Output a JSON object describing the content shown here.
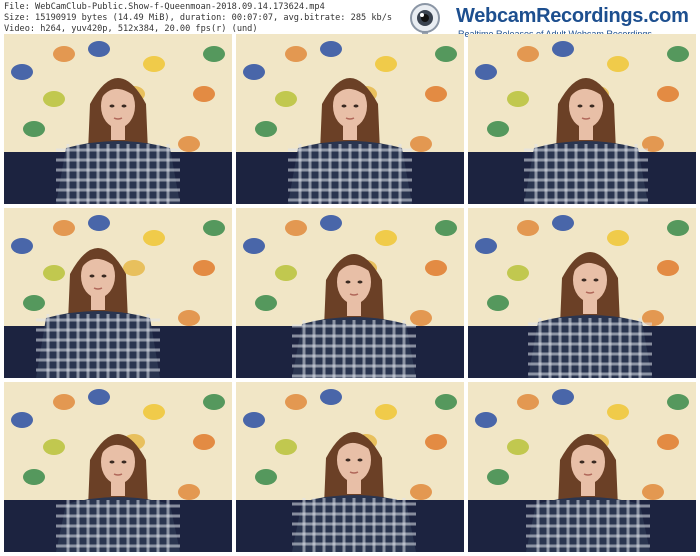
{
  "header": {
    "file_line": "File: WebCamClub-Public.Show-f-Queenmoan-2018.09.14.173624.mp4",
    "size_line": "Size: 15190919 bytes (14.49 MiB), duration: 00:07:07, avg.bitrate: 285 kb/s",
    "video_line": "Video: h264, yuv420p, 512x384, 20.00 fps(r) (und)"
  },
  "logo": {
    "title": "WebcamRecordings.com",
    "subtitle": "Realtime Releases of Adult Webcam Recordings"
  },
  "thumbnails": [
    {
      "name": "frame-1"
    },
    {
      "name": "frame-2"
    },
    {
      "name": "frame-3"
    },
    {
      "name": "frame-4"
    },
    {
      "name": "frame-5"
    },
    {
      "name": "frame-6"
    },
    {
      "name": "frame-7"
    },
    {
      "name": "frame-8"
    },
    {
      "name": "frame-9"
    }
  ],
  "colors": {
    "curtain": "#f1e6c6",
    "sofa": "#1c2340",
    "shirt_dark": "#2a3550",
    "shirt_light": "#dfe4ec",
    "hair": "#6b4026",
    "skin": "#e8bfa7",
    "logo_blue": "#1d4f8f"
  }
}
